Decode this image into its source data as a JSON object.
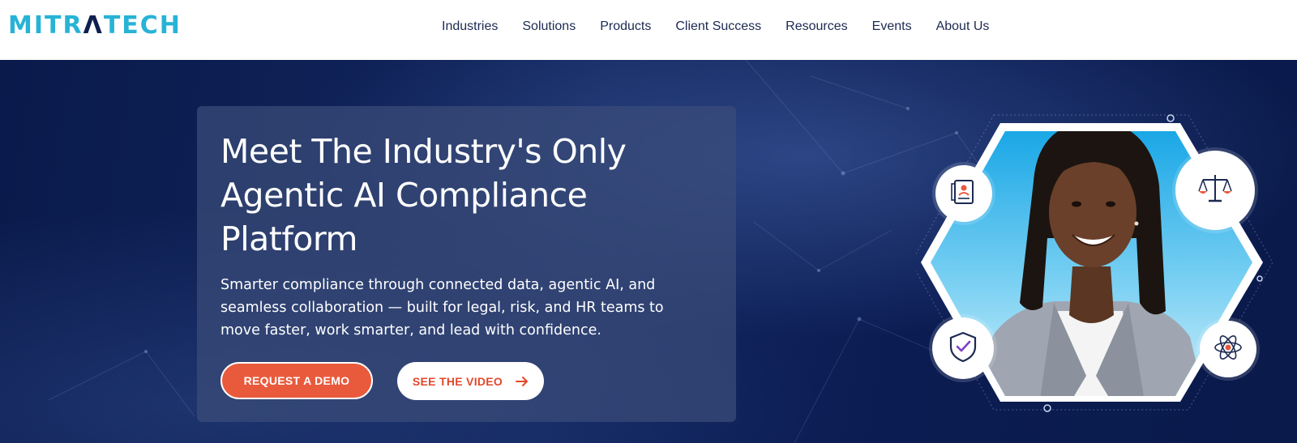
{
  "header": {
    "logo_text_1": "MITR",
    "logo_text_2": "Λ",
    "logo_text_3": "TECH",
    "nav": [
      "Industries",
      "Solutions",
      "Products",
      "Client Success",
      "Resources",
      "Events",
      "About Us"
    ]
  },
  "hero": {
    "title_line_1": "Meet The Industry's Only",
    "title_line_2": "Agentic AI Compliance",
    "title_line_3": "Platform",
    "subtitle": "Smarter compliance through connected data, agentic AI, and seamless collaboration — built for legal, risk, and HR teams to move faster, work smarter, and lead with confidence.",
    "primary_button": "REQUEST A DEMO",
    "secondary_button": "SEE THE VIDEO"
  },
  "icons": {
    "badges": [
      "id-card-icon",
      "scales-icon",
      "shield-check-icon",
      "atom-icon"
    ],
    "video_arrow": "arrow-right-icon"
  },
  "colors": {
    "brand_teal": "#27b3d6",
    "navy": "#0a1a4a",
    "accent_orange": "#e95a3c"
  }
}
